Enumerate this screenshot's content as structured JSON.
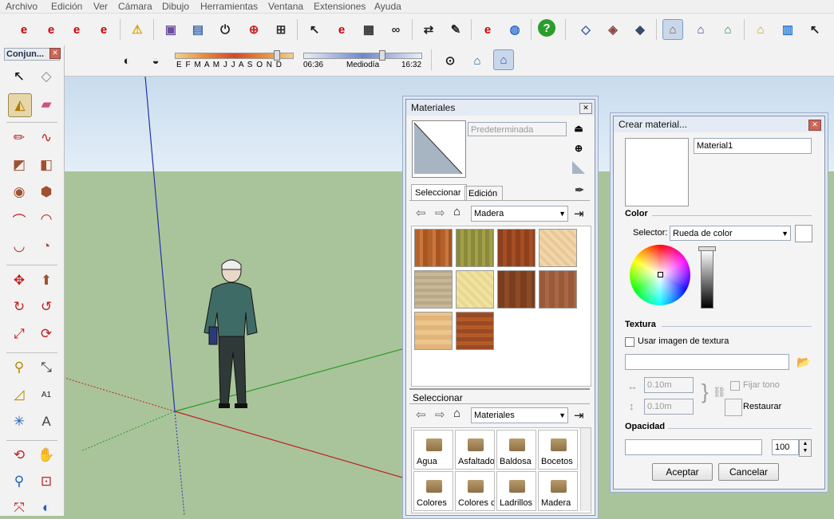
{
  "menu": [
    "Archivo",
    "Edición",
    "Ver",
    "Cámara",
    "Dibujo",
    "Herramientas",
    "Ventana",
    "Extensiones",
    "Ayuda"
  ],
  "shadow_bar": {
    "months": "E F M A M J J A S O N D",
    "time_start": "06:36",
    "time_mid": "Mediodía",
    "time_end": "16:32"
  },
  "left_panel": {
    "title": "Conjun..."
  },
  "materials": {
    "title": "Materiales",
    "current_name": "Predeterminada",
    "tab_select": "Seleccionar",
    "tab_edit": "Edición",
    "library_dropdown": "Madera",
    "lower_label": "Seleccionar",
    "lower_dropdown": "Materiales",
    "folders": [
      "Agua",
      "Asfaltado",
      "Baldosa",
      "Bocetos",
      "Colores",
      "Colores c",
      "Ladrillos",
      "Madera"
    ]
  },
  "create_material": {
    "title": "Crear material...",
    "name_value": "Material1",
    "color_section": "Color",
    "selector_label": "Selector:",
    "selector_value": "Rueda de color",
    "texture_section": "Textura",
    "use_texture_label": "Usar imagen de textura",
    "width_value": "0.10m",
    "height_value": "0.10m",
    "fix_tone_label": "Fijar tono",
    "restore_label": "Restaurar",
    "opacity_section": "Opacidad",
    "opacity_value": "100",
    "accept_button": "Aceptar",
    "cancel_button": "Cancelar"
  }
}
